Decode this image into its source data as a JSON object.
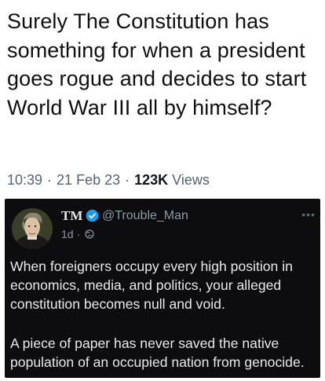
{
  "tweet": {
    "text": "Surely The Constitution has something for when a president goes rogue and decides to start World War III all by himself?",
    "time": "10:39",
    "date": "21 Feb 23",
    "views_count": "123K",
    "views_label": "Views"
  },
  "quoted": {
    "name": "TM",
    "handle": "@Trouble_Man",
    "age": "1d",
    "paragraph_1": "When foreigners occupy every high position in economics, media, and politics, your alleged constitution becomes null and void.",
    "paragraph_2": "A piece of paper has never saved the native population of an occupied nation from genocide.",
    "icons": {
      "verified": "verified-badge-icon",
      "audience": "globe-icon",
      "more": "more-icon"
    }
  },
  "colors": {
    "page_bg": "#ffffff",
    "text_primary": "#0f0f0f",
    "text_meta": "#536471",
    "card_bg": "#0d0d0f",
    "card_text": "#e7e9ea",
    "card_meta": "#8b98a5",
    "verified": "#1d9bf0"
  }
}
